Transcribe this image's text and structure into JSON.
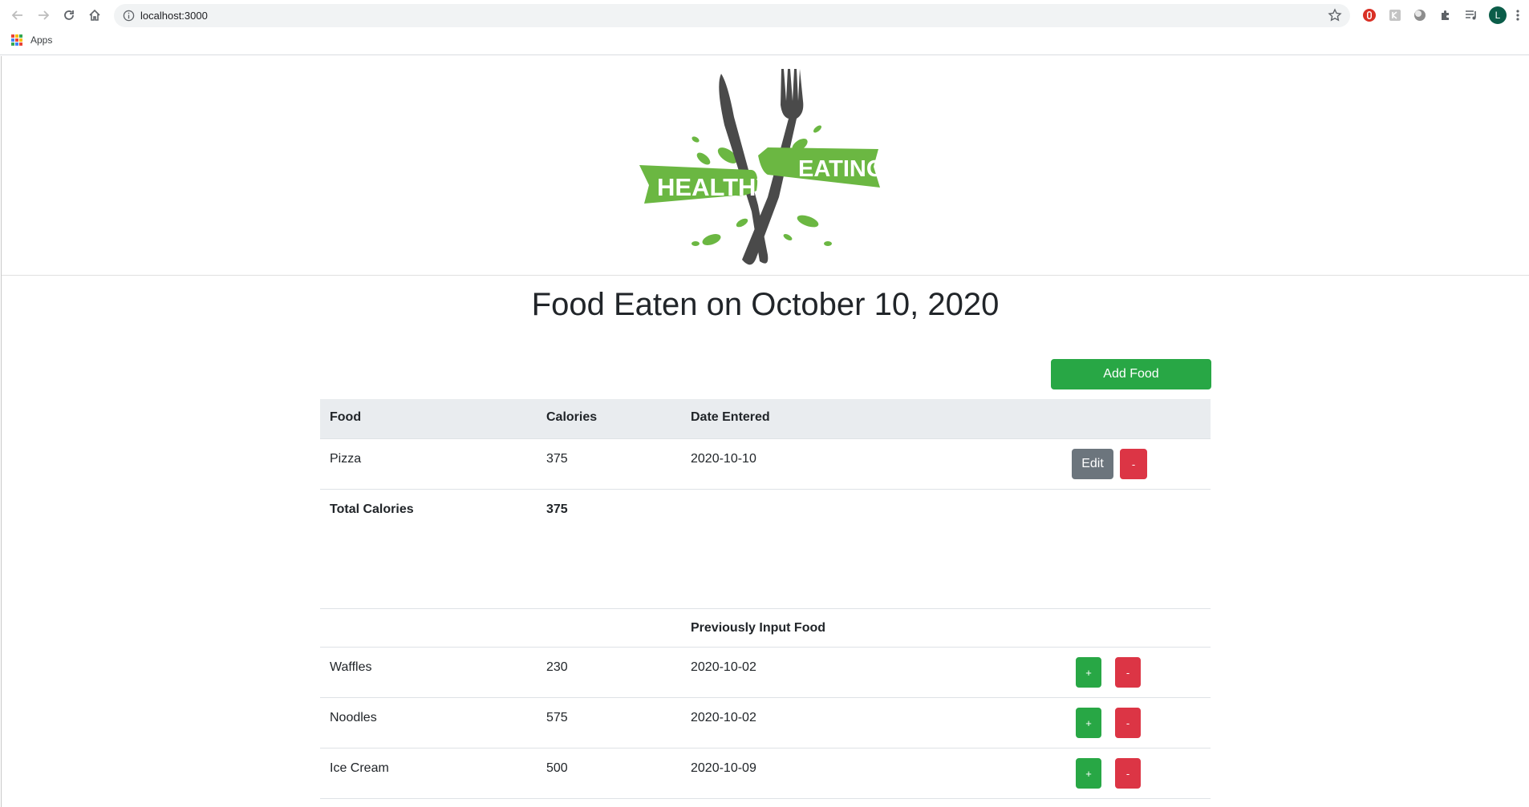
{
  "browser": {
    "url": "localhost:3000",
    "bookmarks_apps_label": "Apps",
    "profile_initial": "L"
  },
  "logo": {
    "text_left": "HEALTHY",
    "text_right": "EATING"
  },
  "page": {
    "title": "Food Eaten on October 10, 2020",
    "add_food_label": "Add Food"
  },
  "today_table": {
    "headers": {
      "food": "Food",
      "calories": "Calories",
      "date": "Date Entered"
    },
    "rows": [
      {
        "food": "Pizza",
        "calories": "375",
        "date": "2020-10-10",
        "edit_label": "Edit",
        "remove_label": "-"
      }
    ],
    "total_label": "Total Calories",
    "total_value": "375"
  },
  "previous_table": {
    "heading": "Previously Input Food",
    "rows": [
      {
        "food": "Waffles",
        "calories": "230",
        "date": "2020-10-02",
        "add_label": "+",
        "remove_label": "-"
      },
      {
        "food": "Noodles",
        "calories": "575",
        "date": "2020-10-02",
        "add_label": "+",
        "remove_label": "-"
      },
      {
        "food": "Ice Cream",
        "calories": "500",
        "date": "2020-10-09",
        "add_label": "+",
        "remove_label": "-"
      }
    ]
  },
  "colors": {
    "success": "#28a745",
    "danger": "#dc3545",
    "secondary": "#6c757d",
    "logo_green": "#6bb742",
    "header_bg": "#e9ecef"
  }
}
